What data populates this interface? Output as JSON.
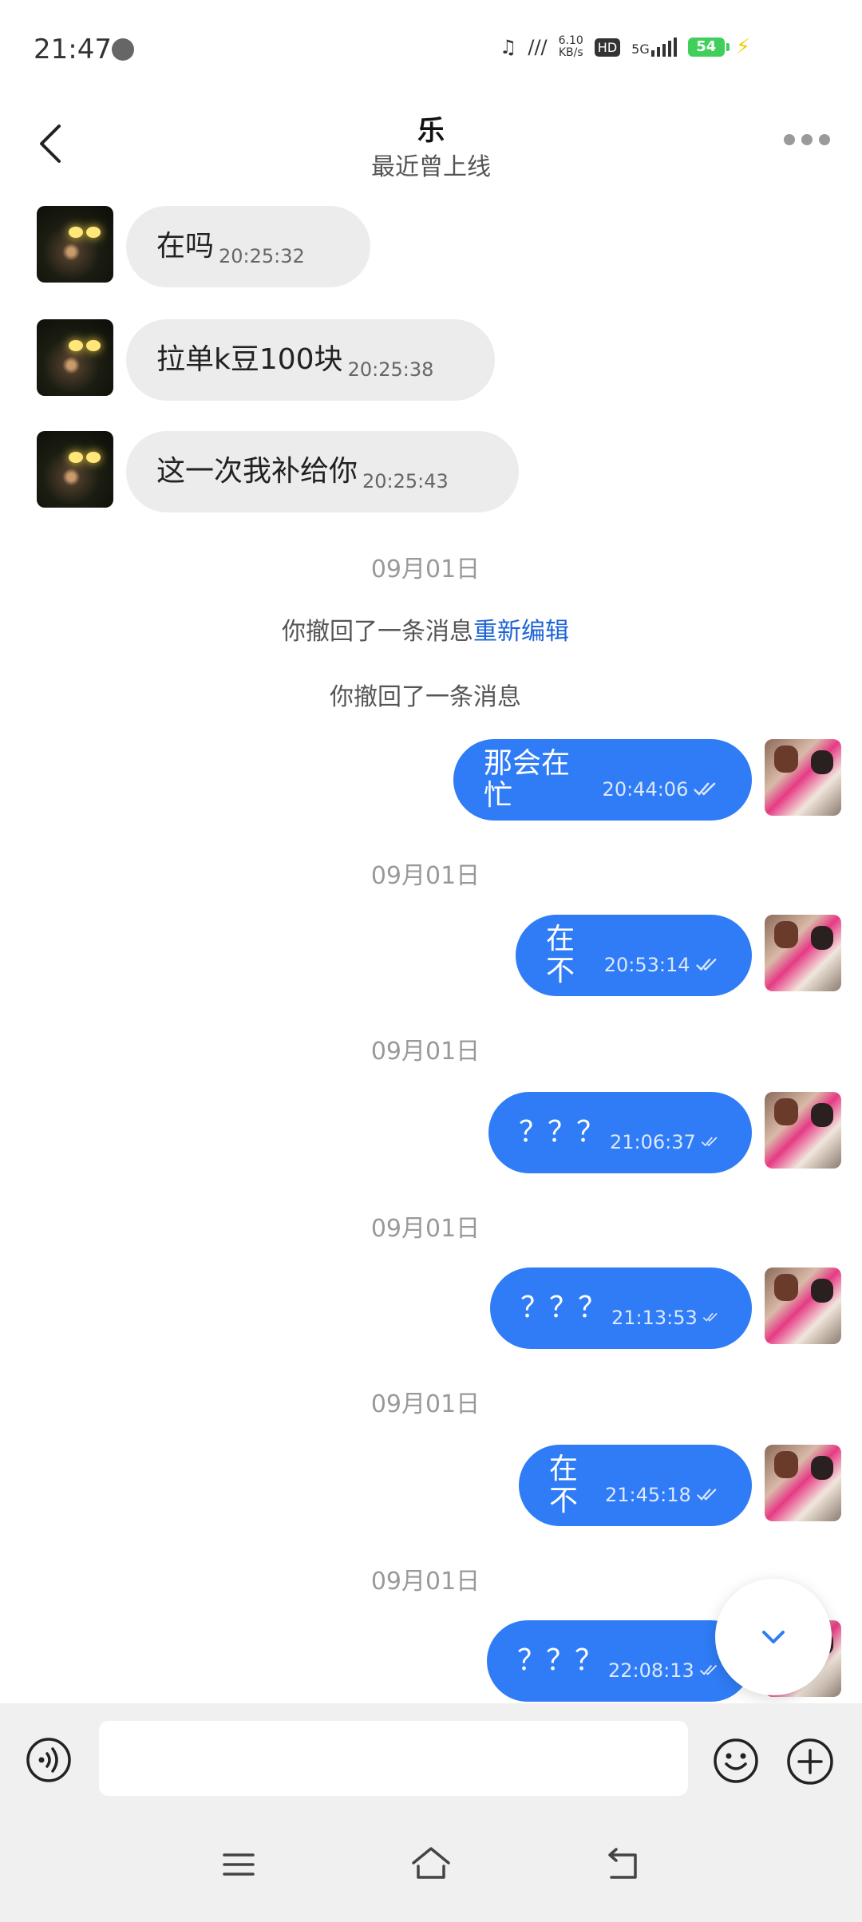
{
  "status_bar": {
    "time": "21:47",
    "net_speed_value": "6.10",
    "net_speed_unit": "KB/s",
    "hd_label": "HD",
    "network_label": "5G",
    "battery": "54"
  },
  "header": {
    "title": "乐",
    "subtitle": "最近曾上线"
  },
  "messages": {
    "in1": {
      "text": "在吗",
      "time": "20:25:32"
    },
    "in2": {
      "text": "拉单k豆100块",
      "time": "20:25:38"
    },
    "in3": {
      "text": "这一次我补给你",
      "time": "20:25:43"
    },
    "out1": {
      "text": "那会在忙",
      "time": "20:44:06"
    },
    "out2": {
      "text": "在不",
      "time": "20:53:14"
    },
    "out3": {
      "text": "？？？",
      "time": "21:06:37"
    },
    "out4": {
      "text": "？？？",
      "time": "21:13:53"
    },
    "out5": {
      "text": "在不",
      "time": "21:45:18"
    },
    "out6": {
      "text": "？？？",
      "time": "22:08:13"
    }
  },
  "dates": {
    "d1": "09月01日",
    "d2": "09月01日",
    "d3": "09月01日",
    "d4": "09月01日",
    "d5": "09月01日",
    "d6": "09月01日"
  },
  "system": {
    "recall1": "你撤回了一条消息",
    "reedit": "重新编辑",
    "recall2": "你撤回了一条消息"
  },
  "input": {
    "placeholder": ""
  },
  "colors": {
    "outgoing_bubble": "#2f7cf6",
    "incoming_bubble": "#ececec",
    "link": "#1c64d6"
  },
  "icons": [
    "back-arrow-icon",
    "more-dots-icon",
    "voice-icon",
    "emoji-icon",
    "plus-icon",
    "chevron-down-icon",
    "menu-icon",
    "home-icon",
    "back-icon",
    "double-check-icon"
  ]
}
